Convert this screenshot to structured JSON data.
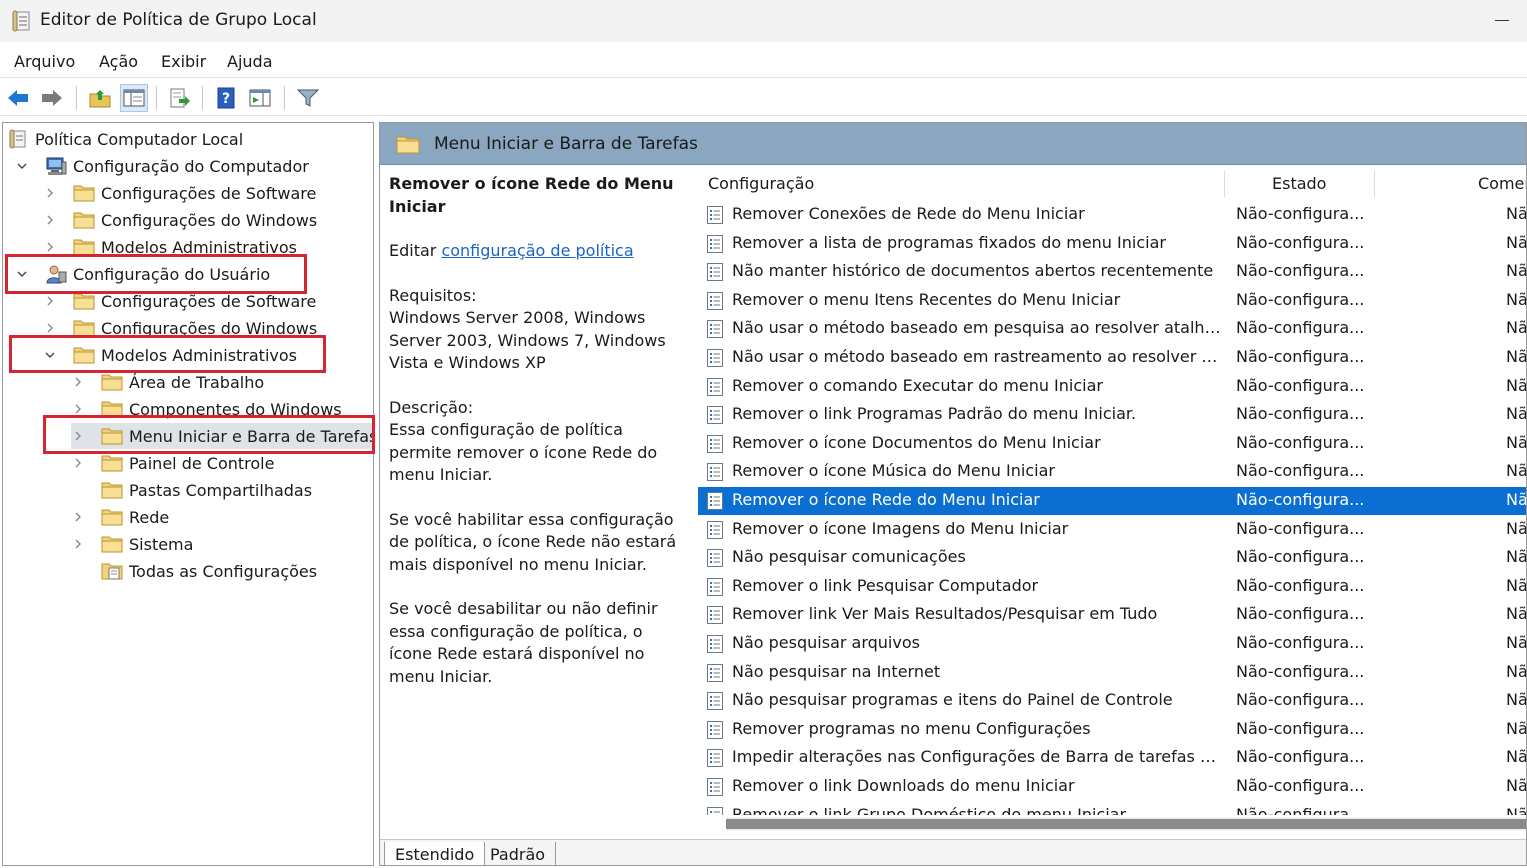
{
  "window": {
    "title": "Editor de Política de Grupo Local"
  },
  "menu": [
    "Arquivo",
    "Ação",
    "Exibir",
    "Ajuda"
  ],
  "toolbar": {
    "buttons": [
      "back-icon",
      "forward-icon",
      "up-folder-icon",
      "show-hide-tree-icon",
      "export-list-icon",
      "help-icon",
      "show-hide-action-pane-icon",
      "filter-icon"
    ]
  },
  "tree": {
    "items": [
      {
        "label": "Política Computador Local",
        "level": 0,
        "icon": "policy-doc-icon",
        "chevron": "none"
      },
      {
        "label": "Configuração do Computador",
        "level": 1,
        "icon": "computer-icon",
        "chevron": "down"
      },
      {
        "label": "Configurações de Software",
        "level": 2,
        "icon": "folder-icon",
        "chevron": "right"
      },
      {
        "label": "Configurações do Windows",
        "level": 2,
        "icon": "folder-icon",
        "chevron": "right"
      },
      {
        "label": "Modelos Administrativos",
        "level": 2,
        "icon": "folder-icon",
        "chevron": "right"
      },
      {
        "label": "Configuração do Usuário",
        "level": 1,
        "icon": "user-icon",
        "chevron": "down"
      },
      {
        "label": "Configurações de Software",
        "level": 2,
        "icon": "folder-icon",
        "chevron": "right"
      },
      {
        "label": "Configurações do Windows",
        "level": 2,
        "icon": "folder-icon",
        "chevron": "right"
      },
      {
        "label": "Modelos Administrativos",
        "level": 2,
        "icon": "folder-icon",
        "chevron": "down"
      },
      {
        "label": "Área de Trabalho",
        "level": 3,
        "icon": "folder-icon",
        "chevron": "right"
      },
      {
        "label": "Componentes do Windows",
        "level": 3,
        "icon": "folder-icon",
        "chevron": "right"
      },
      {
        "label": "Menu Iniciar e Barra de Tarefas",
        "level": 3,
        "icon": "folder-icon",
        "chevron": "right",
        "selected": true
      },
      {
        "label": "Painel de Controle",
        "level": 3,
        "icon": "folder-icon",
        "chevron": "right"
      },
      {
        "label": "Pastas Compartilhadas",
        "level": 3,
        "icon": "folder-icon",
        "chevron": "none"
      },
      {
        "label": "Rede",
        "level": 3,
        "icon": "folder-icon",
        "chevron": "right"
      },
      {
        "label": "Sistema",
        "level": 3,
        "icon": "folder-icon",
        "chevron": "right"
      },
      {
        "label": "Todas as Configurações",
        "level": 3,
        "icon": "all-settings-icon",
        "chevron": "none"
      }
    ]
  },
  "right": {
    "header_title": "Menu Iniciar e Barra de Tarefas",
    "description": {
      "title": "Remover o ícone Rede do Menu Iniciar",
      "edit_prefix": "Editar ",
      "edit_link": "configuração de política",
      "requirements_label": "Requisitos:",
      "requirements": "Windows Server 2008, Windows Server 2003, Windows 7, Windows Vista e Windows XP",
      "description_label": "Descrição:",
      "description": "Essa configuração de política permite remover o ícone Rede do menu Iniciar.",
      "enabled_text": "Se você habilitar essa configuração de política, o ícone Rede não estará mais disponível no menu Iniciar.",
      "disabled_text": "Se você desabilitar ou não definir essa configuração de política, o ícone Rede estará disponível no menu Iniciar."
    },
    "columns": {
      "setting": "Configuração",
      "state": "Estado",
      "comment": "Comer"
    },
    "rows": [
      {
        "name": "Remover Conexões de Rede do Menu Iniciar",
        "state": "Não-configura...",
        "comment": "Nã"
      },
      {
        "name": "Remover a lista de programas fixados do menu Iniciar",
        "state": "Não-configura...",
        "comment": "Nã"
      },
      {
        "name": "Não manter histórico de documentos abertos recentemente",
        "state": "Não-configura...",
        "comment": "Nã"
      },
      {
        "name": "Remover o menu Itens Recentes do Menu Iniciar",
        "state": "Não-configura...",
        "comment": "Nã"
      },
      {
        "name": "Não usar o método baseado em pesquisa ao resolver atalhos...",
        "state": "Não-configura...",
        "comment": "Nã"
      },
      {
        "name": "Não usar o método baseado em rastreamento ao resolver ata...",
        "state": "Não-configura...",
        "comment": "Nã"
      },
      {
        "name": "Remover o comando Executar do menu Iniciar",
        "state": "Não-configura...",
        "comment": "Nã"
      },
      {
        "name": "Remover o link Programas Padrão do menu Iniciar.",
        "state": "Não-configura...",
        "comment": "Nã"
      },
      {
        "name": "Remover o ícone Documentos do Menu Iniciar",
        "state": "Não-configura...",
        "comment": "Nã"
      },
      {
        "name": "Remover o ícone Música do Menu Iniciar",
        "state": "Não-configura...",
        "comment": "Nã"
      },
      {
        "name": "Remover o ícone Rede do Menu Iniciar",
        "state": "Não-configura...",
        "comment": "Nã",
        "selected": true
      },
      {
        "name": "Remover o ícone Imagens do Menu Iniciar",
        "state": "Não-configura...",
        "comment": "Nã"
      },
      {
        "name": "Não pesquisar comunicações",
        "state": "Não-configura...",
        "comment": "Nã"
      },
      {
        "name": "Remover o link Pesquisar Computador",
        "state": "Não-configura...",
        "comment": "Nã"
      },
      {
        "name": "Remover link Ver Mais Resultados/Pesquisar em Tudo",
        "state": "Não-configura...",
        "comment": "Nã"
      },
      {
        "name": "Não pesquisar arquivos",
        "state": "Não-configura...",
        "comment": "Nã"
      },
      {
        "name": "Não pesquisar na Internet",
        "state": "Não-configura...",
        "comment": "Nã"
      },
      {
        "name": "Não pesquisar programas e itens do Painel de Controle",
        "state": "Não-configura...",
        "comment": "Nã"
      },
      {
        "name": "Remover programas no menu Configurações",
        "state": "Não-configura...",
        "comment": "Nã"
      },
      {
        "name": "Impedir alterações nas Configurações de Barra de tarefas e m...",
        "state": "Não-configura...",
        "comment": "Nã"
      },
      {
        "name": "Remover o link Downloads do menu Iniciar",
        "state": "Não-configura...",
        "comment": "Nã"
      },
      {
        "name": "Remover o link Grupo Doméstico do menu Iniciar",
        "state": "Não-configura...",
        "comment": "Nã"
      }
    ]
  },
  "tabs": [
    "Estendido",
    "Padrão"
  ],
  "colors": {
    "selection": "#0a6fd0",
    "header_band": "#8aa6c1",
    "highlight_box": "#d9232e",
    "link": "#1a64c8"
  }
}
